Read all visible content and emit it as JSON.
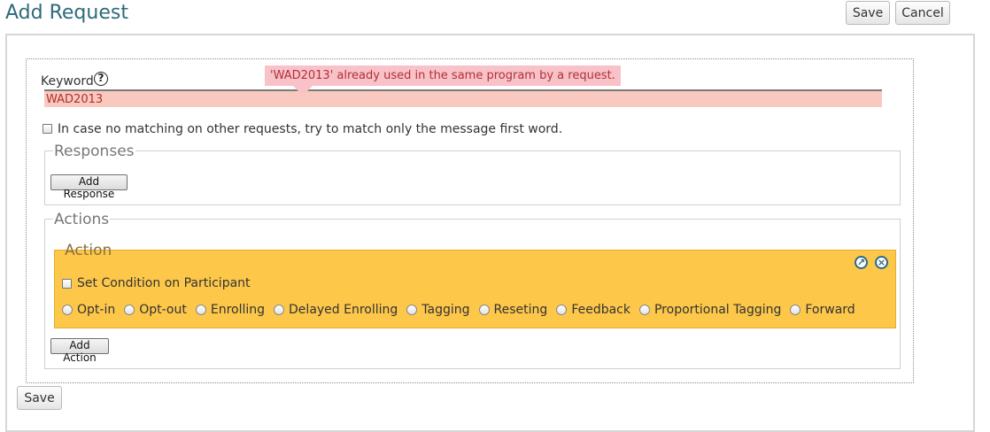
{
  "page": {
    "title": "Add Request"
  },
  "toolbar": {
    "save_label": "Save",
    "cancel_label": "Cancel"
  },
  "form": {
    "keyword_label": "Keyword",
    "help_icon": "question-mark-icon",
    "keyword_value": "WAD2013",
    "keyword_error": "'WAD2013' already used in the same program by a request.",
    "first_word_label": "In case no matching on other requests, try to match only the message first word.",
    "first_word_checked": false
  },
  "responses": {
    "legend": "Responses",
    "add_button_label": "Add Response"
  },
  "actions": {
    "legend": "Actions",
    "add_button_label": "Add Action",
    "action": {
      "legend": "Action",
      "expand_icon": "expand-arrow-icon",
      "remove_icon": "close-circle-icon",
      "condition_label": "Set Condition on Participant",
      "condition_checked": false,
      "types": [
        "Opt-in",
        "Opt-out",
        "Enrolling",
        "Delayed Enrolling",
        "Tagging",
        "Reseting",
        "Feedback",
        "Proportional Tagging",
        "Forward"
      ]
    }
  },
  "footer": {
    "save_label": "Save"
  },
  "colors": {
    "title": "#2d6a7a",
    "error_background": "#f8c2c8",
    "error_text": "#b0303a",
    "action_background": "#fdc74a",
    "icon_color": "#2a6a8a"
  }
}
